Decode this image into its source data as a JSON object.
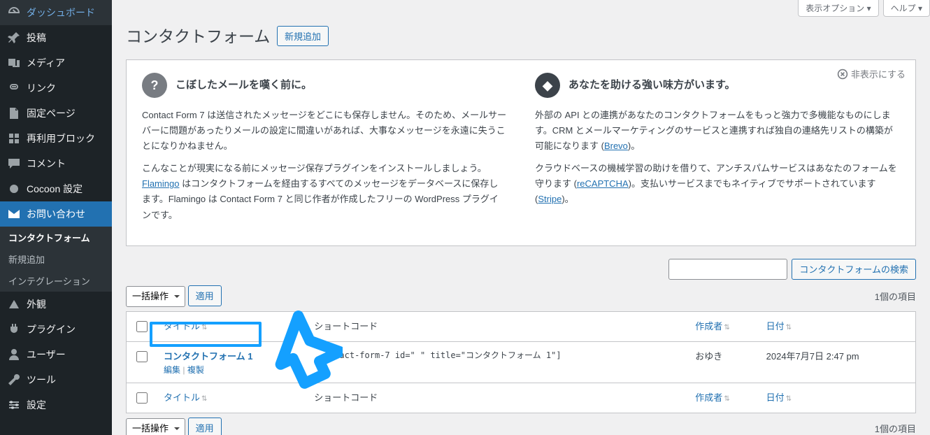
{
  "screen": {
    "options": "表示オプション ▾",
    "help": "ヘルプ ▾"
  },
  "sidebar": {
    "items": [
      {
        "label": "ダッシュボード"
      },
      {
        "label": "投稿"
      },
      {
        "label": "メディア"
      },
      {
        "label": "リンク"
      },
      {
        "label": "固定ページ"
      },
      {
        "label": "再利用ブロック"
      },
      {
        "label": "コメント"
      },
      {
        "label": "Cocoon 設定"
      },
      {
        "label": "お問い合わせ"
      },
      {
        "label": "外観"
      },
      {
        "label": "プラグイン"
      },
      {
        "label": "ユーザー"
      },
      {
        "label": "ツール"
      },
      {
        "label": "設定"
      }
    ],
    "sub": {
      "items": [
        {
          "label": "コンタクトフォーム",
          "current": true
        },
        {
          "label": "新規追加"
        },
        {
          "label": "インテグレーション"
        }
      ]
    }
  },
  "header": {
    "title": "コンタクトフォーム",
    "add_new": "新規追加"
  },
  "welcome": {
    "dismiss": "非表示にする",
    "left": {
      "heading": "こぼしたメールを嘆く前に。",
      "p1": "Contact Form 7 は送信されたメッセージをどこにも保存しません。そのため、メールサーバーに問題があったりメールの設定に間違いがあれば、大事なメッセージを永遠に失うことになりかねません。",
      "p2a": "こんなことが現実になる前にメッセージ保存プラグインをインストールしましょう。",
      "p2_link": "Flamingo",
      "p2b": " はコンタクトフォームを経由するすべてのメッセージをデータベースに保存します。Flamingo は Contact Form 7 と同じ作者が作成したフリーの WordPress プラグインです。"
    },
    "right": {
      "heading": "あなたを助ける強い味方がいます。",
      "p1a": "外部の API との連携があなたのコンタクトフォームをもっと強力で多機能なものにします。CRM とメールマーケティングのサービスと連携すれば独自の連絡先リストの構築が可能になります (",
      "p1_link": "Brevo",
      "p1b": ")。",
      "p2a": "クラウドベースの機械学習の助けを借りて、アンチスパムサービスはあなたのフォームを守ります (",
      "p2_link1": "reCAPTCHA",
      "p2b": ")。支払いサービスまでもネイティブでサポートされています (",
      "p2_link2": "Stripe",
      "p2c": ")。"
    }
  },
  "search": {
    "placeholder": "",
    "button": "コンタクトフォームの検索"
  },
  "bulk": {
    "placeholder": "一括操作",
    "apply": "適用"
  },
  "count": "1個の項目",
  "columns": {
    "title": "タイトル",
    "shortcode": "ショートコード",
    "author": "作成者",
    "date": "日付"
  },
  "rows": [
    {
      "title": "コンタクトフォーム 1",
      "actions": {
        "edit": "編集",
        "sep": " | ",
        "dup": "複製"
      },
      "shortcode": "[contact-form-7 id=\"         \" title=\"コンタクトフォーム 1\"]",
      "author": "おゆき",
      "date": "2024年7月7日 2:47 pm"
    }
  ],
  "sort_glyph": "▲▼"
}
